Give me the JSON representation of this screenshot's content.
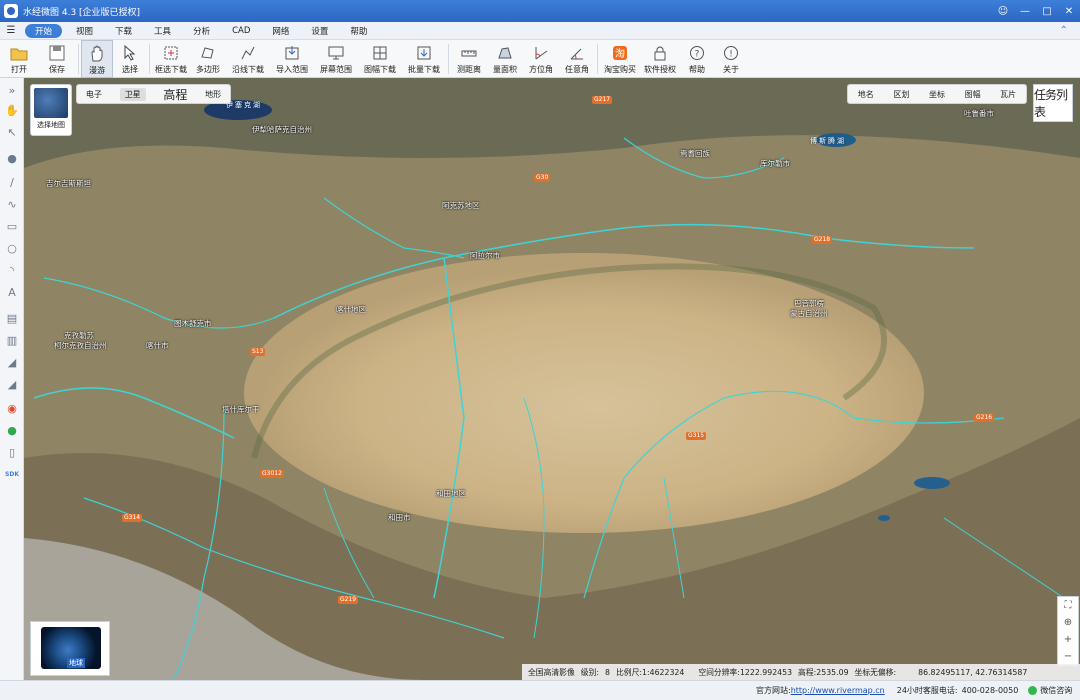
{
  "app": {
    "title": "水经微图 4.3 [企业版已授权]"
  },
  "menu": {
    "items": [
      "开始",
      "视图",
      "下载",
      "工具",
      "分析",
      "CAD",
      "网络",
      "设置",
      "帮助"
    ],
    "active": "开始"
  },
  "toolbar": {
    "open": "打开",
    "save": "保存",
    "pan": "漫游",
    "select": "选择",
    "frame_download": "框选下载",
    "polygon": "多边形",
    "line_download": "沿线下载",
    "import_range": "导入范围",
    "screen_range": "屏幕范围",
    "sheet_download": "图幅下载",
    "batch_download": "批量下载",
    "measure_distance": "测距离",
    "measure_area": "量面积",
    "bearing": "方位角",
    "arbitrary_angle": "任意角",
    "taobao": "淘宝购买",
    "license": "软件授权",
    "help": "帮助",
    "about": "关于"
  },
  "map": {
    "selector_label": "选择地图",
    "types": [
      "电子",
      "卫星",
      "高程",
      "地形"
    ],
    "active_type": "卫星",
    "overlays": [
      "地名",
      "区划",
      "坐标",
      "图幅",
      "瓦片"
    ],
    "task_list": "任务列表",
    "globe_label": "地球",
    "labels": [
      {
        "text": "伊犁哈萨克自治州",
        "name": "label-yili"
      },
      {
        "text": "吉尔吉斯斯坦",
        "name": "label-kyrgyzstan"
      },
      {
        "text": "阿克苏地区",
        "name": "label-aksu"
      },
      {
        "text": "阿拉尔市",
        "name": "label-alar"
      },
      {
        "text": "巴音郭楞",
        "name": "label-bayingol-1"
      },
      {
        "text": "蒙古自治州",
        "name": "label-bayingol-2"
      },
      {
        "text": "焉耆回族",
        "name": "label-yanqi"
      },
      {
        "text": "库尔勒市",
        "name": "label-korla"
      },
      {
        "text": "喀什地区",
        "name": "label-kashgar-region"
      },
      {
        "text": "克孜勒苏",
        "name": "label-kizilsu"
      },
      {
        "text": "柯尔克孜自治州",
        "name": "label-kizilsu-2"
      },
      {
        "text": "喀什市",
        "name": "label-kashgar-city"
      },
      {
        "text": "图木舒克市",
        "name": "label-tumxuk"
      },
      {
        "text": "和田地区",
        "name": "label-hotan"
      },
      {
        "text": "和田市",
        "name": "label-hotan-city"
      },
      {
        "text": "塔什库尔干",
        "name": "label-tashkurgan"
      },
      {
        "text": "吐鲁番市",
        "name": "label-turpan"
      }
    ],
    "lakes": [
      {
        "text": "伊塞克湖",
        "name": "lake-issyk-kul"
      },
      {
        "text": "博斯腾湖",
        "name": "lake-bosten"
      }
    ],
    "roads": [
      "G217",
      "G218",
      "G3012",
      "G314",
      "G315",
      "G216",
      "G30",
      "S13",
      "G219"
    ],
    "status": {
      "source": "全国高清影像",
      "level_label": "级别:",
      "level": "8",
      "scale_label": "比例尺:",
      "scale": "1:4622324",
      "resolution_label": "空间分辨率:",
      "resolution": "1222.992453",
      "elevation_label": "高程:",
      "elevation": "2535.09",
      "offset_label": "坐标无偏移:",
      "coords": "86.82495117, 42.76314587"
    }
  },
  "statusbar": {
    "site_label": "官方网站:",
    "site_url": "http://www.rivermap.cn",
    "hotline_label": "24小时客服电话:",
    "hotline": "400-028-0050",
    "wechat": "微信咨询"
  }
}
